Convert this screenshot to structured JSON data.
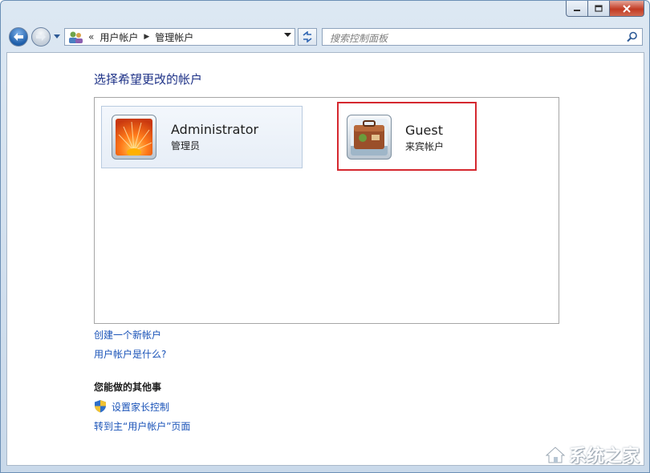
{
  "address": {
    "overflow": "«",
    "crumbs": [
      "用户帐户",
      "管理帐户"
    ]
  },
  "search": {
    "placeholder": "搜索控制面板"
  },
  "main": {
    "heading": "选择希望更改的帐户",
    "accounts": [
      {
        "name": "Administrator",
        "role": "管理员",
        "picture": "orange-flower"
      },
      {
        "name": "Guest",
        "role": "来宾帐户",
        "picture": "suitcase",
        "highlighted": true,
        "highlight_color": "#d5282f"
      }
    ],
    "links": {
      "create_account": "创建一个新帐户",
      "what_is_account": "用户帐户是什么?"
    },
    "other": {
      "title": "您能做的其他事",
      "parental_controls": "设置家长控制",
      "go_main_page": "转到主“用户帐户”页面"
    }
  },
  "watermark": {
    "text": "系统之家"
  },
  "colors": {
    "link": "#1a53b8",
    "heading": "#1e3287",
    "close_button": "#c23a23"
  }
}
